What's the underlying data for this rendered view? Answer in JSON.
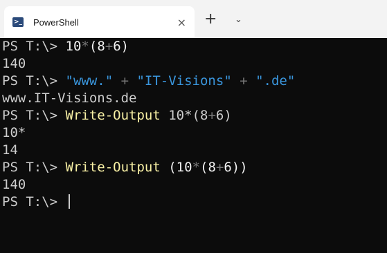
{
  "tab": {
    "title": "PowerShell",
    "close_glyph": "×",
    "icon_glyph": ">_"
  },
  "toolbar": {
    "new_tab_glyph": "+",
    "dropdown_glyph": "⌄"
  },
  "terminal": {
    "prompt": "PS T:\\> ",
    "lines": [
      [
        {
          "t": "PS T:\\> ",
          "c": "def"
        },
        {
          "t": "10",
          "c": "num"
        },
        {
          "t": "*",
          "c": "op"
        },
        {
          "t": "(",
          "c": "num"
        },
        {
          "t": "8",
          "c": "num"
        },
        {
          "t": "+",
          "c": "op"
        },
        {
          "t": "6",
          "c": "num"
        },
        {
          "t": ")",
          "c": "num"
        }
      ],
      [
        {
          "t": "140",
          "c": "def"
        }
      ],
      [
        {
          "t": "PS T:\\> ",
          "c": "def"
        },
        {
          "t": "\"www.\"",
          "c": "str"
        },
        {
          "t": " + ",
          "c": "op"
        },
        {
          "t": "\"IT-Visions\"",
          "c": "str"
        },
        {
          "t": " + ",
          "c": "op"
        },
        {
          "t": "\".de\"",
          "c": "str"
        }
      ],
      [
        {
          "t": "www.IT-Visions.de",
          "c": "def"
        }
      ],
      [
        {
          "t": "PS T:\\> ",
          "c": "def"
        },
        {
          "t": "Write-Output",
          "c": "cmd"
        },
        {
          "t": " 10*(8",
          "c": "def"
        },
        {
          "t": "+",
          "c": "op"
        },
        {
          "t": "6)",
          "c": "def"
        }
      ],
      [
        {
          "t": "10*",
          "c": "def"
        }
      ],
      [
        {
          "t": "14",
          "c": "def"
        }
      ],
      [
        {
          "t": "PS T:\\> ",
          "c": "def"
        },
        {
          "t": "Write-Output",
          "c": "cmd"
        },
        {
          "t": " (10",
          "c": "num"
        },
        {
          "t": "*",
          "c": "op"
        },
        {
          "t": "(8",
          "c": "num"
        },
        {
          "t": "+",
          "c": "op"
        },
        {
          "t": "6))",
          "c": "num"
        }
      ],
      [
        {
          "t": "140",
          "c": "def"
        }
      ],
      [
        {
          "t": "PS T:\\> ",
          "c": "def"
        }
      ]
    ]
  },
  "colors": {
    "background": "#0c0c0c",
    "default_text": "#cccccc",
    "string": "#3a96dd",
    "command": "#f9f1a5",
    "operator": "#767676"
  }
}
